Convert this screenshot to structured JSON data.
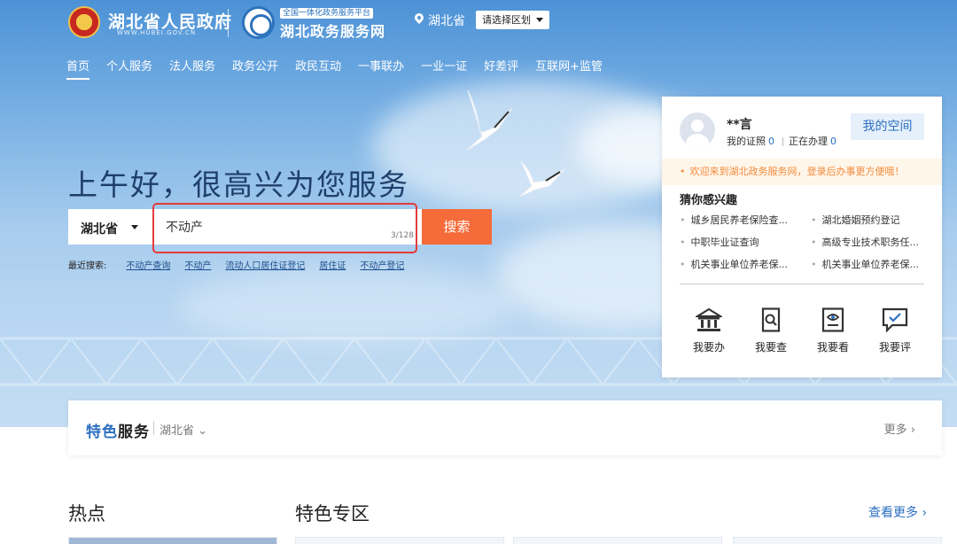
{
  "header": {
    "site_name": "湖北省人民政府",
    "site_sub": "WWW.HUBEI.GOV.CN",
    "service_badge": "全国一体化政务服务平台",
    "service_name": "湖北政务服务网",
    "location": "湖北省",
    "region_select": "请选择区划"
  },
  "nav": [
    "首页",
    "个人服务",
    "法人服务",
    "政务公开",
    "政民互动",
    "一事联办",
    "一业一证",
    "好差评",
    "互联网+监管"
  ],
  "hero": {
    "greeting": "上午好，很高兴为您服务",
    "search": {
      "province": "湖北省",
      "value": "不动产",
      "counter": "3/128",
      "button": "搜索"
    },
    "recent": {
      "label": "最近搜索:",
      "items": [
        "不动产查询",
        "不动产",
        "流动人口居住证登记",
        "居住证",
        "不动产登记"
      ]
    }
  },
  "user_panel": {
    "name": "**言",
    "licenses_label": "我的证照",
    "licenses_count": "0",
    "inprogress_label": "正在办理",
    "inprogress_count": "0",
    "myspace": "我的空间",
    "notice": "欢迎来到湖北政务服务网，登录后办事更方便哦！",
    "interest_title": "猜你感兴趣",
    "interests": [
      "城乡居民养老保险查...",
      "湖北婚姻预约登记",
      "中职毕业证查询",
      "高级专业技术职务任...",
      "机关事业单位养老保...",
      "机关事业单位养老保..."
    ],
    "actions": [
      {
        "label": "我要办",
        "icon": "bank-icon"
      },
      {
        "label": "我要查",
        "icon": "search-doc-icon"
      },
      {
        "label": "我要看",
        "icon": "view-screen-icon"
      },
      {
        "label": "我要评",
        "icon": "comment-check-icon"
      }
    ]
  },
  "featured": {
    "title_a": "特色",
    "title_b": "服务",
    "region": "湖北省",
    "more": "更多"
  },
  "sections": {
    "hot": "热点",
    "zone": "特色专区",
    "see_more": "查看更多"
  },
  "colors": {
    "accent": "#2b6fc0",
    "search_button": "#f56b3a",
    "highlight_box": "#e33b3b",
    "notice_text": "#f28b3c"
  }
}
